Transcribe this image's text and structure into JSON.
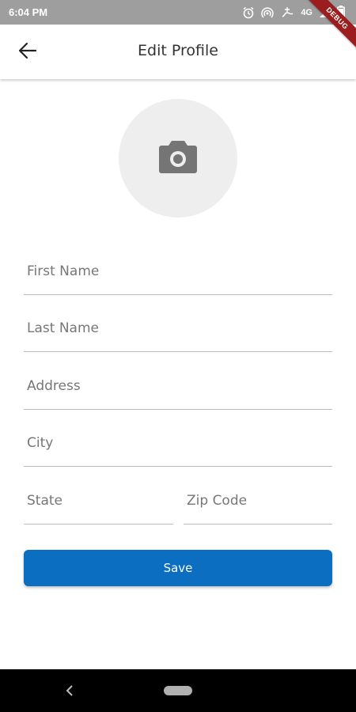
{
  "status_bar": {
    "time": "6:04 PM",
    "network": "4G",
    "icons": [
      "alarm-icon",
      "hotspot-icon",
      "data-saver-icon",
      "signal-icon",
      "battery-icon"
    ]
  },
  "debug_banner": "DEBUG",
  "app_bar": {
    "title": "Edit Profile",
    "back_icon": "arrow-left-icon"
  },
  "avatar": {
    "icon": "camera-icon"
  },
  "form": {
    "first_name": {
      "placeholder": "First Name",
      "value": ""
    },
    "last_name": {
      "placeholder": "Last Name",
      "value": ""
    },
    "address": {
      "placeholder": "Address",
      "value": ""
    },
    "city": {
      "placeholder": "City",
      "value": ""
    },
    "state": {
      "placeholder": "State",
      "value": ""
    },
    "zip_code": {
      "placeholder": "Zip Code",
      "value": ""
    },
    "save_label": "Save"
  },
  "nav_bar": {
    "icons": [
      "nav-back-icon",
      "nav-home-pill"
    ]
  },
  "colors": {
    "primary": "#0b6ec1",
    "status_bar": "#9e9e9e",
    "avatar_bg": "#eeeeee",
    "debug_ribbon": "#9b1d1d"
  }
}
